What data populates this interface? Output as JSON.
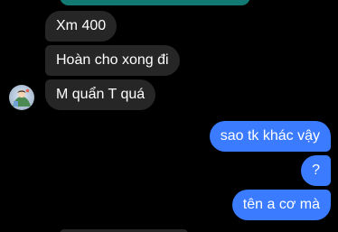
{
  "messages": {
    "incoming": [
      {
        "text": "Xm 400"
      },
      {
        "text": "Hoàn cho xong đi"
      },
      {
        "text": "M quẩn T quá"
      }
    ],
    "outgoing": [
      {
        "text": "sao tk khác vậy"
      },
      {
        "text": "?"
      },
      {
        "text": "tên a cơ mà"
      }
    ]
  },
  "colors": {
    "background": "#000000",
    "incoming_bubble": "#262626",
    "outgoing_bubble": "#3a7bff",
    "text": "#ffffff",
    "top_fragment": "#127a73"
  },
  "icons": {
    "contact_avatar": "avatar-icon"
  }
}
